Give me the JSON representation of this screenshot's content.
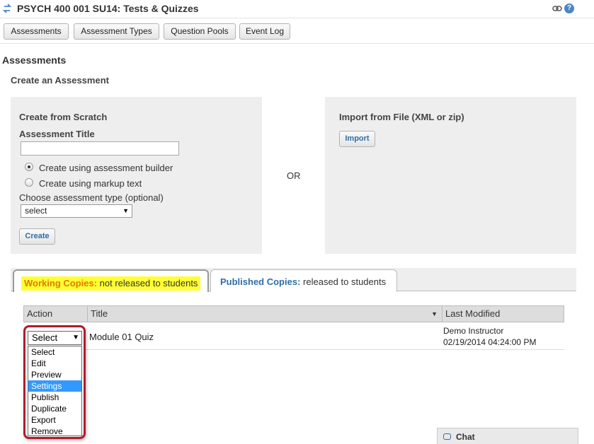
{
  "header": {
    "title": "PSYCH 400 001 SU14: Tests & Quizzes",
    "help_glyph": "?"
  },
  "toolbar": {
    "buttons": [
      {
        "label": "Assessments"
      },
      {
        "label": "Assessment Types"
      },
      {
        "label": "Question Pools"
      },
      {
        "label": "Event Log"
      }
    ]
  },
  "page": {
    "section_title": "Assessments",
    "sub_title": "Create an Assessment",
    "or_label": "OR"
  },
  "create_scratch": {
    "heading": "Create from Scratch",
    "title_label": "Assessment Title",
    "title_value": "",
    "radio_builder": "Create using assessment builder",
    "radio_markup": "Create using markup text",
    "type_label": "Choose assessment type (optional)",
    "type_value": "select",
    "create_button": "Create"
  },
  "import_file": {
    "heading": "Import from File (XML or zip)",
    "import_button": "Import"
  },
  "tabs": {
    "working": {
      "key": "Working Copies:",
      "rest": "not released to students"
    },
    "published": {
      "key": "Published Copies:",
      "rest": "released to students"
    }
  },
  "table": {
    "headers": {
      "action": "Action",
      "title": "Title",
      "modified": "Last Modified"
    },
    "rows": [
      {
        "title": "Module 01 Quiz",
        "modified_by": "Demo Instructor",
        "modified_at": "02/19/2014 04:24:00 PM"
      }
    ]
  },
  "action_dropdown": {
    "value": "Select",
    "options": [
      "Select",
      "Edit",
      "Preview",
      "Settings",
      "Publish",
      "Duplicate",
      "Export",
      "Remove"
    ],
    "highlighted": "Settings"
  },
  "chat": {
    "label": "Chat"
  },
  "colors": {
    "highlight": "#ffff33",
    "callout_border": "#b01c2e",
    "link_blue": "#2f6da6",
    "selection": "#3399ff"
  }
}
